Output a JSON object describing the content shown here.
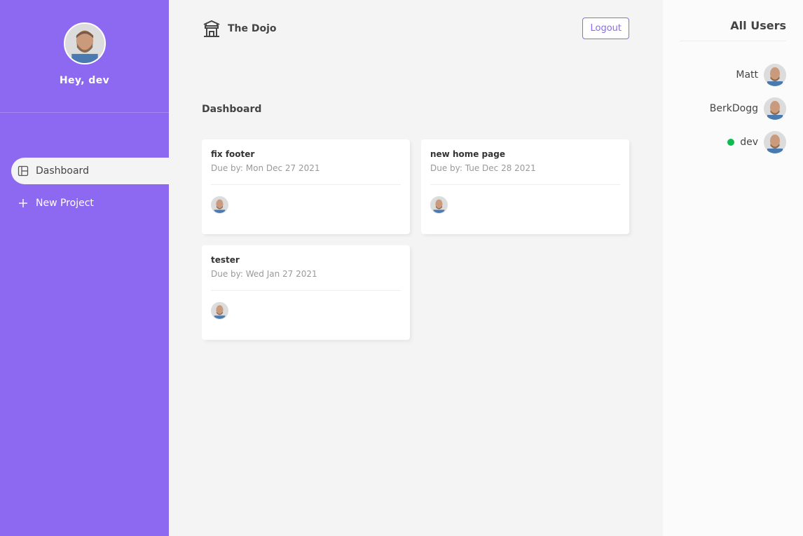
{
  "sidebar": {
    "greeting": "Hey, dev",
    "nav": [
      {
        "label": "Dashboard",
        "icon": "dashboard-icon",
        "active": true
      },
      {
        "label": "New Project",
        "icon": "plus-icon",
        "active": false
      }
    ]
  },
  "navbar": {
    "title": "The Dojo",
    "logo_icon": "temple-icon",
    "logout_label": "Logout"
  },
  "main": {
    "page_title": "Dashboard",
    "projects": [
      {
        "name": "fix footer",
        "due": "Due by: Mon Dec 27 2021"
      },
      {
        "name": "new home page",
        "due": "Due by: Tue Dec 28 2021"
      },
      {
        "name": "tester",
        "due": "Due by: Wed Jan 27 2021"
      }
    ]
  },
  "users": {
    "title": "All Users",
    "list": [
      {
        "name": "Matt",
        "online": false
      },
      {
        "name": "BerkDogg",
        "online": false
      },
      {
        "name": "dev",
        "online": true
      }
    ]
  },
  "colors": {
    "accent": "#8d69f1",
    "online": "#0ebb50"
  }
}
